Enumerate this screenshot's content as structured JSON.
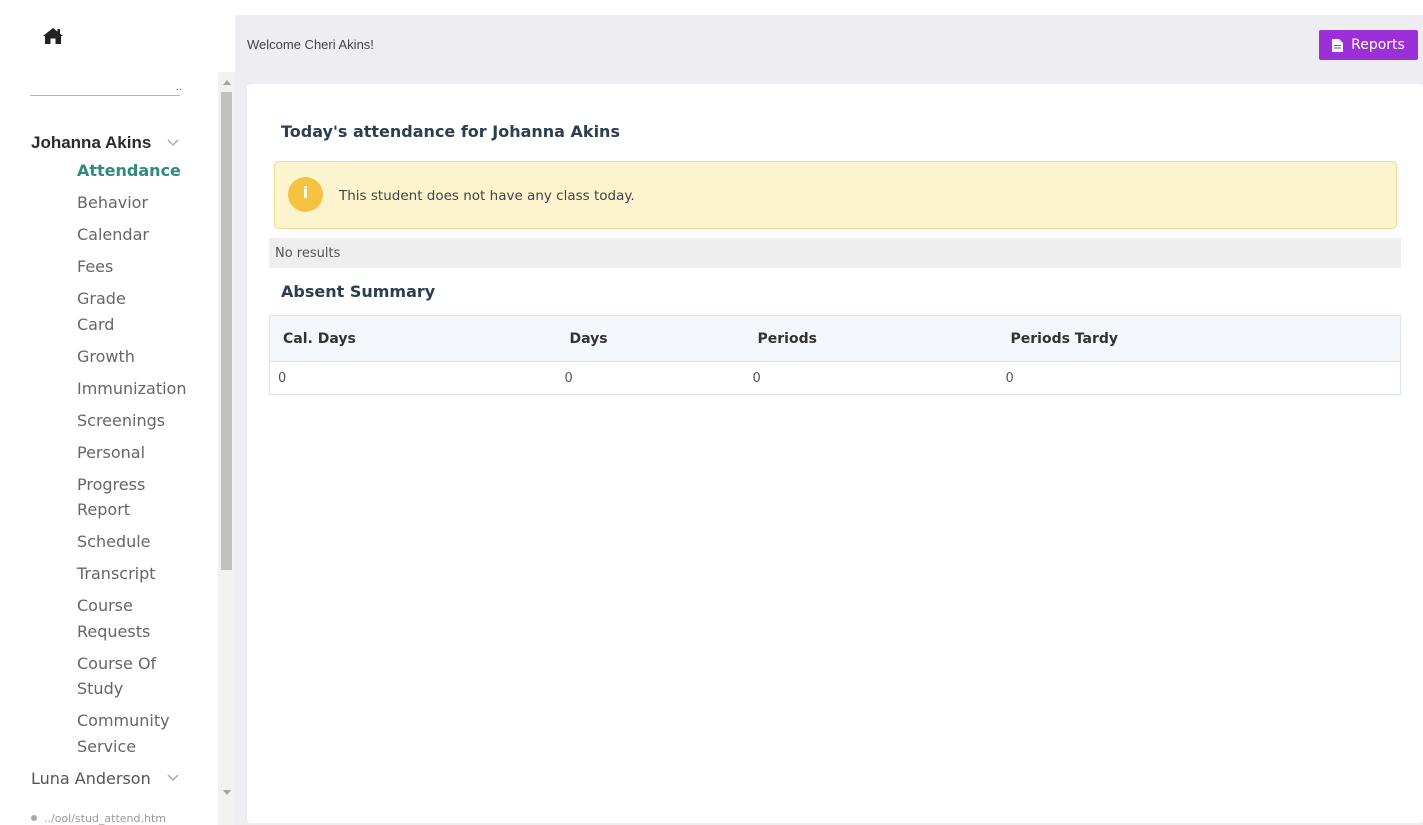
{
  "header": {
    "welcome": "Welcome Cheri Akins!",
    "reports_label": "Reports",
    "reports_color": "#9b30d9"
  },
  "sidebar": {
    "home_icon": "home-icon",
    "student": {
      "name": "Johanna Akins",
      "menu": [
        {
          "label": "Attendance",
          "active": true
        },
        {
          "label": "Behavior"
        },
        {
          "label": "Calendar"
        },
        {
          "label": "Fees"
        },
        {
          "label": "Grade Card"
        },
        {
          "label": "Growth"
        },
        {
          "label": "Immunization"
        },
        {
          "label": "Screenings"
        },
        {
          "label": "Personal"
        },
        {
          "label": "Progress Report"
        },
        {
          "label": "Schedule"
        },
        {
          "label": "Transcript"
        },
        {
          "label": "Course Requests"
        },
        {
          "label": "Course Of Study"
        },
        {
          "label": "Community Service"
        }
      ]
    },
    "student2": {
      "name": "Luna Anderson"
    },
    "status_url": "../ool/stud_attend.htm"
  },
  "main": {
    "title": "Today's attendance for Johanna Akins",
    "alert": {
      "icon": "info-icon",
      "icon_glyph": "i",
      "text": "This student does not have any class today."
    },
    "no_results": "No results",
    "summary": {
      "title": "Absent Summary",
      "columns": [
        "Cal. Days",
        "Days",
        "Periods",
        "Periods Tardy"
      ],
      "rows": [
        [
          "0",
          "0",
          "0",
          "0"
        ]
      ]
    }
  }
}
